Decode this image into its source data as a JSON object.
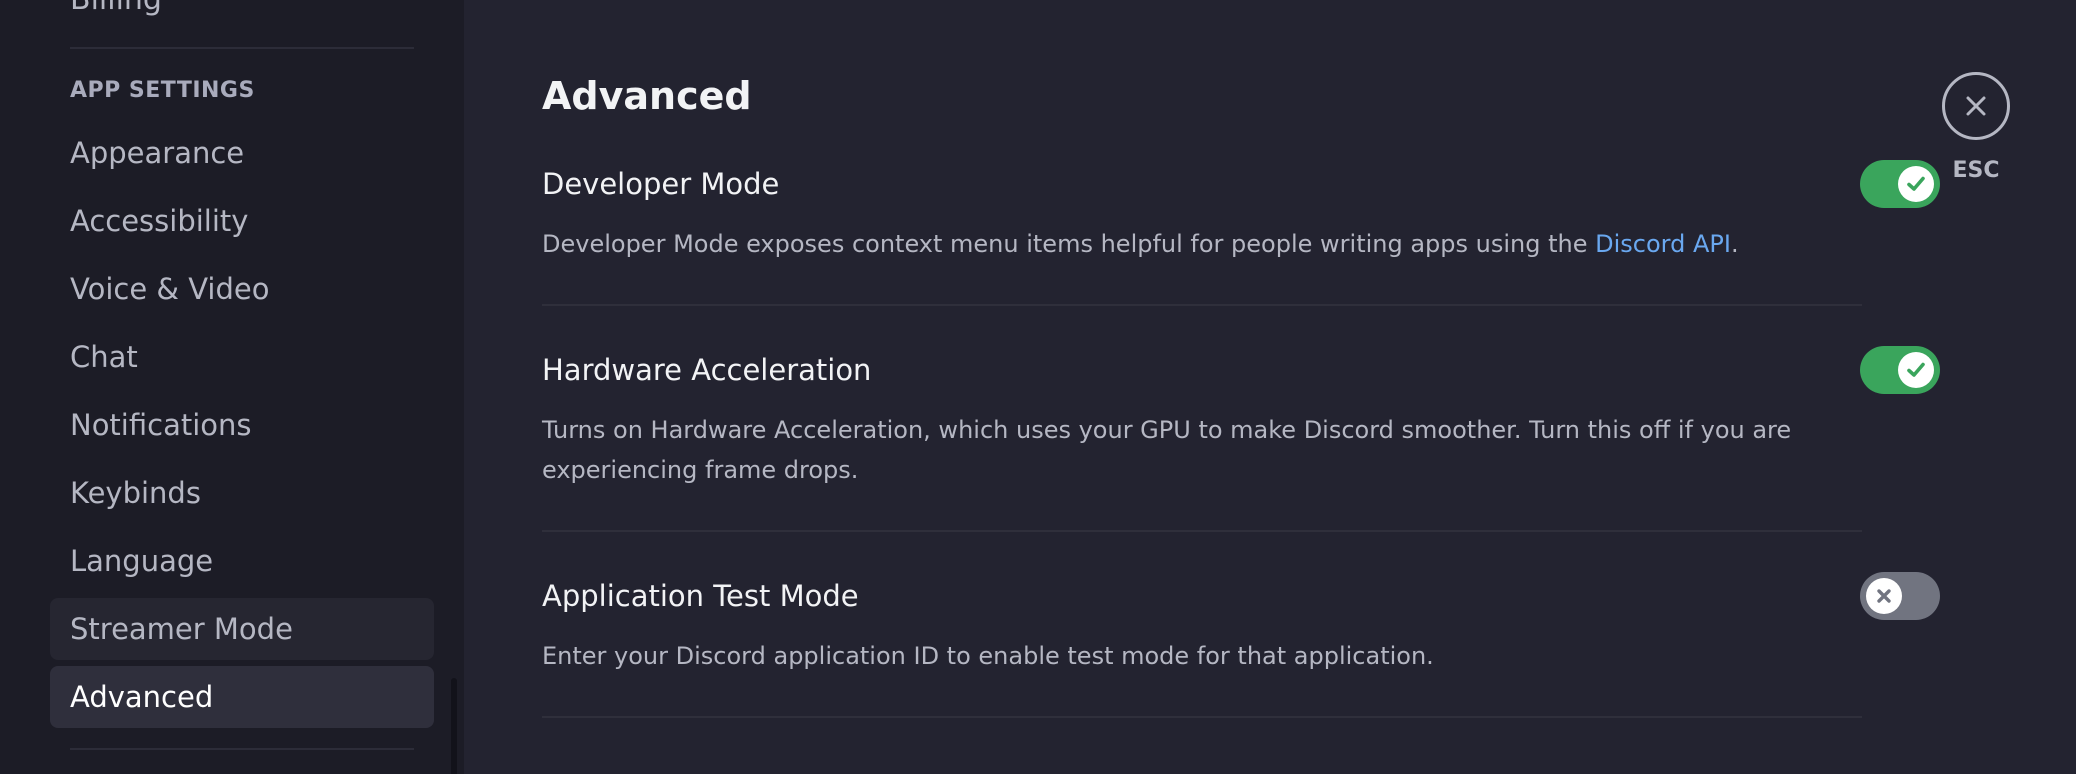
{
  "sidebar": {
    "clipped_item": "Billing",
    "section_header": "APP SETTINGS",
    "items": [
      {
        "label": "Appearance"
      },
      {
        "label": "Accessibility"
      },
      {
        "label": "Voice & Video"
      },
      {
        "label": "Chat"
      },
      {
        "label": "Notifications"
      },
      {
        "label": "Keybinds"
      },
      {
        "label": "Language"
      },
      {
        "label": "Streamer Mode"
      },
      {
        "label": "Advanced"
      }
    ],
    "active_item": "Advanced"
  },
  "main": {
    "title": "Advanced",
    "settings": [
      {
        "title": "Developer Mode",
        "description": "Developer Mode exposes context menu items helpful for people writing apps using the ",
        "link_text": "Discord API",
        "description_end": ".",
        "enabled": true
      },
      {
        "title": "Hardware Acceleration",
        "description_line1": "Turns on Hardware Acceleration, which uses your GPU to make Discord smoother. Turn this off if you are",
        "description_line2": "experiencing frame drops.",
        "enabled": true
      },
      {
        "title": "Application Test Mode",
        "description": "Enter your Discord application ID to enable test mode for that application.",
        "enabled": false
      }
    ]
  },
  "close": {
    "label": "ESC",
    "icon": "close-icon"
  },
  "colors": {
    "toggle_on": "#3aa55c",
    "toggle_off": "#717480",
    "link": "#6aa8f0",
    "background": "#232330",
    "sidebar_background": "#1c1c26"
  }
}
